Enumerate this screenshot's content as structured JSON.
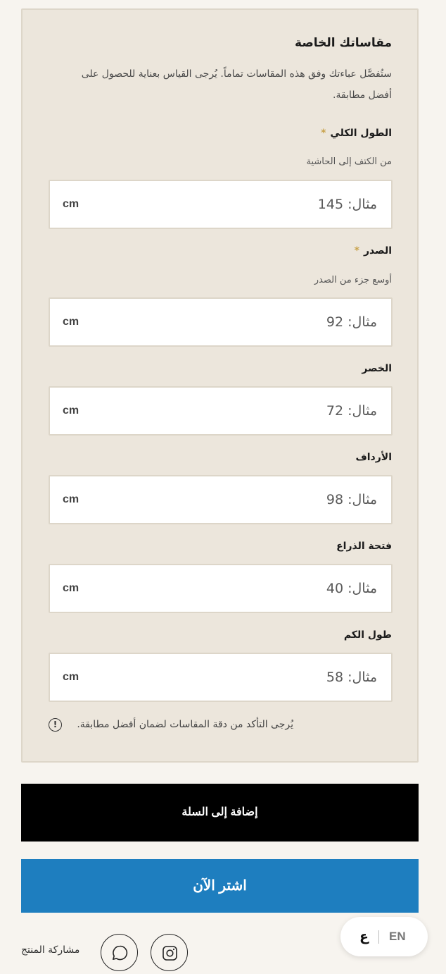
{
  "measurements": {
    "title": "مقاساتك الخاصة",
    "description": "ستُفصَّل عباءتك وفق هذه المقاسات تماماً. يُرجى القياس بعناية للحصول على أفضل مطابقة.",
    "required_mark": "*",
    "unit": "cm",
    "fields": [
      {
        "label": "الطول الكلي",
        "required": true,
        "hint": "من الكتف إلى الحاشية",
        "placeholder": "مثال: 145",
        "value": ""
      },
      {
        "label": "الصدر",
        "required": true,
        "hint": "أوسع جزء من الصدر",
        "placeholder": "مثال: 92",
        "value": ""
      },
      {
        "label": "الخصر",
        "required": false,
        "placeholder": "مثال: 72",
        "value": ""
      },
      {
        "label": "الأرداف",
        "required": false,
        "placeholder": "مثال: 98",
        "value": ""
      },
      {
        "label": "فتحة الذراع",
        "required": false,
        "placeholder": "مثال: 40",
        "value": ""
      },
      {
        "label": "طول الكم",
        "required": false,
        "placeholder": "مثال: 58",
        "value": ""
      }
    ],
    "note": "يُرجى التأكد من دقة المقاسات لضمان أفضل مطابقة."
  },
  "actions": {
    "add_to_cart": "إضافة إلى السلة",
    "buy_now": "اشتر الآن"
  },
  "share": {
    "label": "مشاركة المنتج",
    "icons": [
      "instagram-icon",
      "whatsapp-icon"
    ]
  },
  "language_switcher": {
    "en": "EN",
    "ar": "ع"
  },
  "colors": {
    "panel_bg": "#ece6dc",
    "page_bg": "#f7f4ef",
    "cart_button": "#000000",
    "buy_button": "#1e7ebf",
    "required_star": "#c8a24a"
  }
}
